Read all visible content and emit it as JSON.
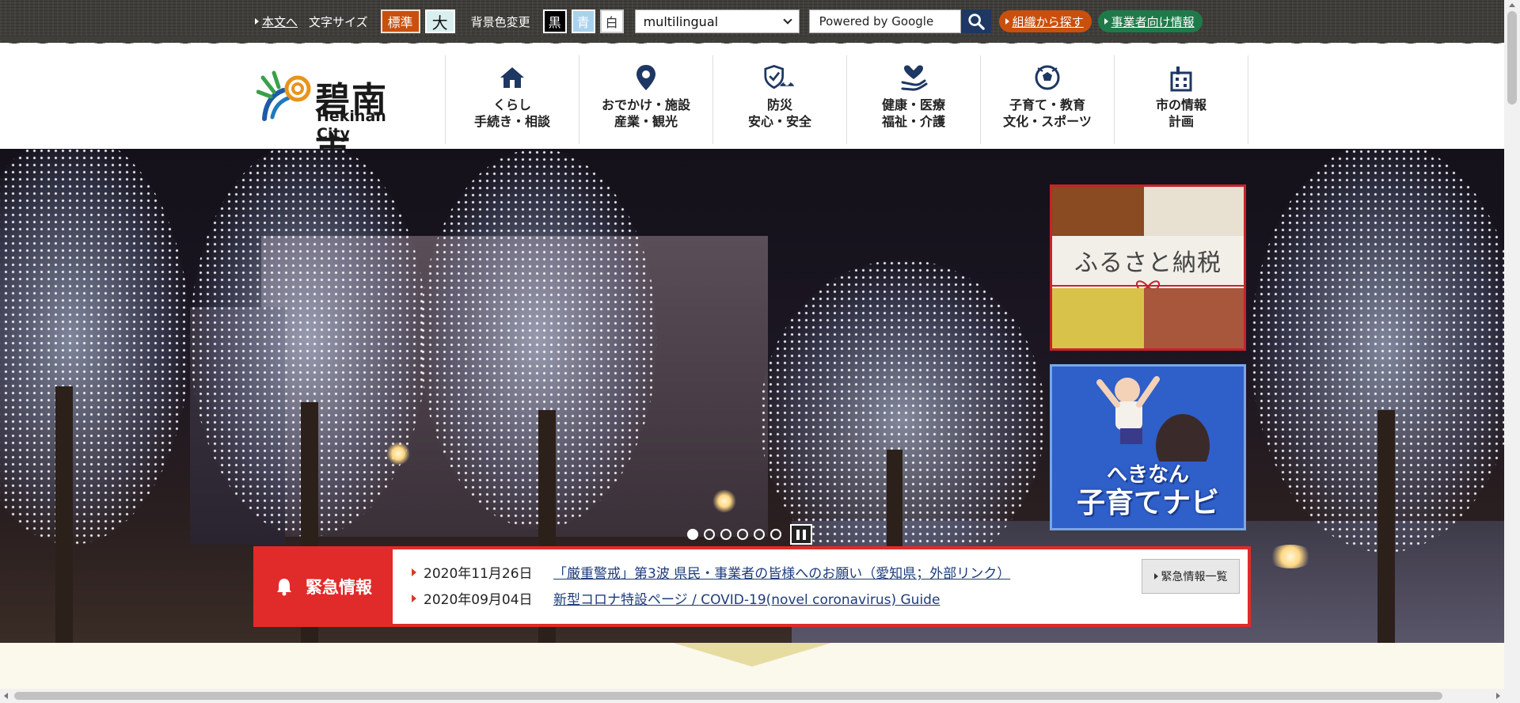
{
  "topbar": {
    "skip_link": "本文へ",
    "font_size_label": "文字サイズ",
    "font_size_standard": "標準",
    "font_size_large": "大",
    "bg_color_label": "背景色変更",
    "bg_black": "黒",
    "bg_blue": "青",
    "bg_white": "白",
    "language_selected": "multilingual",
    "search_placeholder": "Powered by Google",
    "org_search": "組織から探す",
    "business_info": "事業者向け情報"
  },
  "logo": {
    "name_ja": "碧南市",
    "name_en": "Hekinan City"
  },
  "gnav": [
    {
      "icon": "house-icon",
      "line1": "くらし",
      "line2": "手続き・相談"
    },
    {
      "icon": "map-pin-icon",
      "line1": "おでかけ・施設",
      "line2": "産業・観光"
    },
    {
      "icon": "shield-icon",
      "line1": "防災",
      "line2": "安心・安全"
    },
    {
      "icon": "heart-hand-icon",
      "line1": "健康・医療",
      "line2": "福祉・介護"
    },
    {
      "icon": "soccer-ball-icon",
      "line1": "子育て・教育",
      "line2": "文化・スポーツ"
    },
    {
      "icon": "city-hall-icon",
      "line1": "市の情報",
      "line2": "計画"
    }
  ],
  "banners": {
    "furusato": "ふるさと納税",
    "kosodate_line1": "へきなん",
    "kosodate_line2": "子育てナビ"
  },
  "slider": {
    "dot_count": 6,
    "active_index": 0
  },
  "emergency": {
    "title": "緊急情報",
    "items": [
      {
        "date": "2020年11月26日",
        "text": "「厳重警戒」第3波 県民・事業者の皆様へのお願い（愛知県；外部リンク）"
      },
      {
        "date": "2020年09月04日",
        "text": "新型コロナ特設ページ / COVID-19(novel coronavirus) Guide"
      }
    ],
    "more_label": "緊急情報一覧"
  },
  "colors": {
    "accent_orange": "#c9500c",
    "accent_green": "#1f7a4a",
    "emergency_red": "#e12a2a",
    "nav_icon": "#1e3763"
  }
}
